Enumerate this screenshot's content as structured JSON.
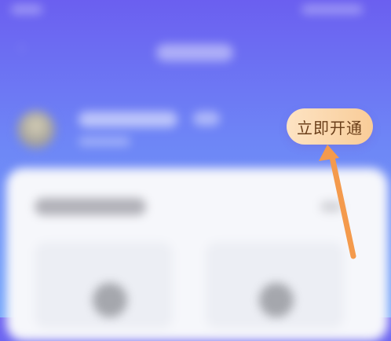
{
  "header": {
    "back_icon": "chevron-left-icon"
  },
  "membership": {
    "activate_label": "立即开通"
  },
  "annotation": {
    "arrow_color": "#f49a4c",
    "arrow_icon": "arrow-up-icon"
  },
  "colors": {
    "gradient_top": "#6b5ff0",
    "gradient_bottom": "#74a6fb",
    "button_bg": "#f9cc98",
    "button_text": "#6b3f1a"
  }
}
